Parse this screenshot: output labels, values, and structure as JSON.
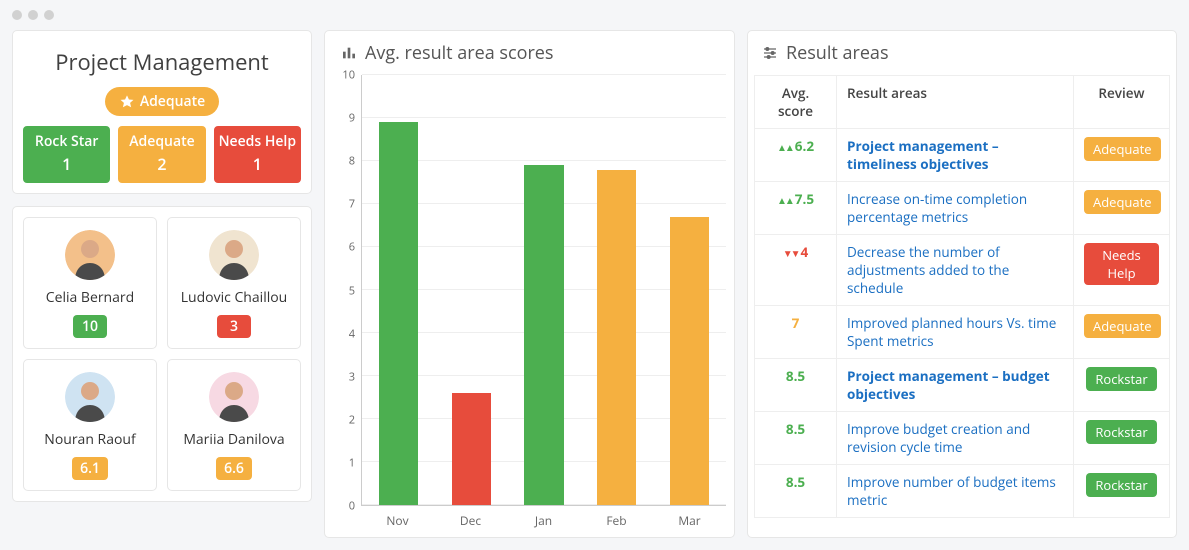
{
  "header": {
    "title": "Project Management",
    "pill_label": "Adequate"
  },
  "stats": [
    {
      "label": "Rock Star",
      "count": "1",
      "color": "green"
    },
    {
      "label": "Adequate",
      "count": "2",
      "color": "yellow"
    },
    {
      "label": "Needs Help",
      "count": "1",
      "color": "red"
    }
  ],
  "people": [
    {
      "name": "Celia Bernard",
      "score": "10",
      "color": "green"
    },
    {
      "name": "Ludovic Chaillou",
      "score": "3",
      "color": "red"
    },
    {
      "name": "Nouran Raouf",
      "score": "6.1",
      "color": "yellow"
    },
    {
      "name": "Mariia Danilova",
      "score": "6.6",
      "color": "yellow"
    }
  ],
  "chart_panel": {
    "title": "Avg. result area scores"
  },
  "chart_data": {
    "type": "bar",
    "categories": [
      "Nov",
      "Dec",
      "Jan",
      "Feb",
      "Mar"
    ],
    "values": [
      8.9,
      2.6,
      7.9,
      7.8,
      6.7
    ],
    "colors": [
      "green",
      "red",
      "green",
      "yellow",
      "yellow"
    ],
    "title": "Avg. result area scores",
    "xlabel": "",
    "ylabel": "",
    "ylim": [
      0,
      10
    ],
    "yticks": [
      0,
      1,
      2,
      3,
      4,
      5,
      6,
      7,
      8,
      9,
      10
    ]
  },
  "result_panel": {
    "title": "Result areas",
    "columns": {
      "avg": "Avg. score",
      "area": "Result areas",
      "review": "Review"
    }
  },
  "result_rows": [
    {
      "score": "6.2",
      "score_color": "green",
      "arrow": "up",
      "area": "Project management – timeliness objectives",
      "bold": true,
      "review": "Adequate",
      "review_color": "yellow"
    },
    {
      "score": "7.5",
      "score_color": "green",
      "arrow": "up",
      "area": "Increase on-time completion percentage metrics",
      "bold": false,
      "review": "Adequate",
      "review_color": "yellow"
    },
    {
      "score": "4",
      "score_color": "red",
      "arrow": "down",
      "area": "Decrease the number of adjustments added to the schedule",
      "bold": false,
      "review": "Needs Help",
      "review_color": "red"
    },
    {
      "score": "7",
      "score_color": "yellow",
      "arrow": "",
      "area": "Improved planned hours Vs. time Spent metrics",
      "bold": false,
      "review": "Adequate",
      "review_color": "yellow"
    },
    {
      "score": "8.5",
      "score_color": "green",
      "arrow": "",
      "area": "Project management – budget objectives",
      "bold": true,
      "review": "Rockstar",
      "review_color": "green"
    },
    {
      "score": "8.5",
      "score_color": "green",
      "arrow": "",
      "area": "Improve budget creation and revision cycle time",
      "bold": false,
      "review": "Rockstar",
      "review_color": "green"
    },
    {
      "score": "8.5",
      "score_color": "green",
      "arrow": "",
      "area": "Improve number of budget items metric",
      "bold": false,
      "review": "Rockstar",
      "review_color": "green"
    }
  ],
  "avatar_palette": [
    "#f3c08a",
    "#f0e4d0",
    "#cfe3f2",
    "#f7d9e3"
  ],
  "color_map": {
    "green": "#4caf50",
    "yellow": "#f5b040",
    "red": "#e74c3c"
  }
}
